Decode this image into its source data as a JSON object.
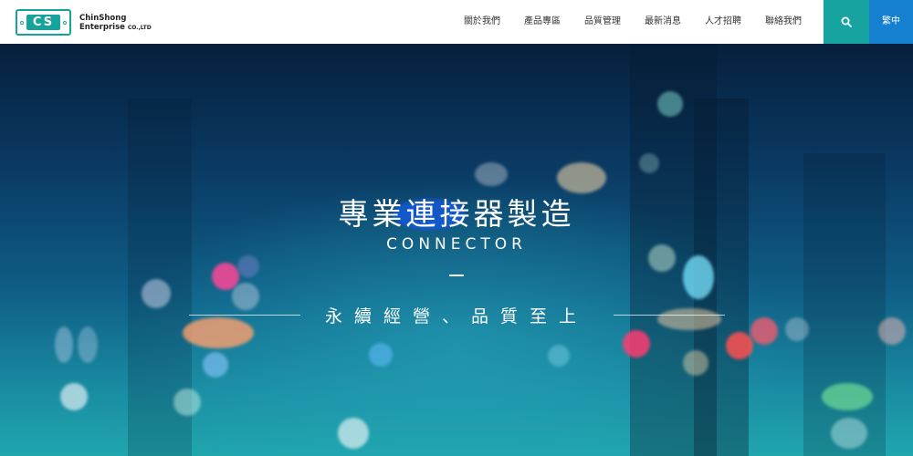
{
  "brand": {
    "mark": "CS",
    "name_line1": "ChinShong",
    "name_line2": "Enterprise",
    "name_suffix": "CO.,LTD"
  },
  "nav": {
    "items": [
      {
        "label": "關於我們"
      },
      {
        "label": "產品專區"
      },
      {
        "label": "品質管理"
      },
      {
        "label": "最新消息"
      },
      {
        "label": "人才招聘"
      },
      {
        "label": "聯絡我們"
      }
    ],
    "search_icon": "search-icon",
    "language": "繁中"
  },
  "hero": {
    "title": "專業連接器製造",
    "subtitle": "CONNECTOR",
    "slogan": "永續經營、品質至上"
  },
  "colors": {
    "teal": "#17a4a0",
    "blue": "#1580cf"
  }
}
